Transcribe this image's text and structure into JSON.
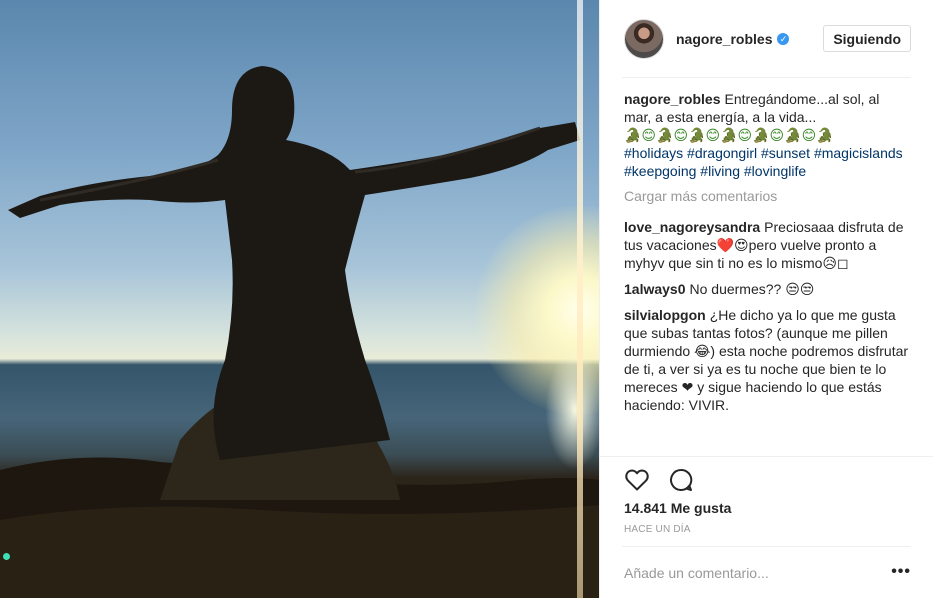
{
  "post": {
    "author": {
      "username": "nagore_robles",
      "verified_icon": "verified-badge-icon",
      "follow_label": "Siguiendo"
    },
    "caption": {
      "username": "nagore_robles",
      "text": "Entregándome...al sol, al mar, a esta energía, a la vida...",
      "emoji_line": "🐊😊🐊😊🐊😊🐊😊🐊😊🐊😊🐊",
      "hashtags": [
        "#holidays",
        "#dragongirl",
        "#sunset",
        "#magicislands",
        "#keepgoing",
        "#living",
        "#lovinglife"
      ]
    },
    "load_more_label": "Cargar más comentarios",
    "comments": [
      {
        "username": "love_nagoreysandra",
        "text": "Preciosaaa disfruta de tus vacaciones❤️😍pero vuelve pronto a myhyv que sin ti no es lo mismo😥◻"
      },
      {
        "username": "1always0",
        "text": "No duermes?? 😒😒"
      },
      {
        "username": "silvialopgon",
        "text": "¿He dicho ya lo que me gusta que subas tantas fotos? (aunque me pillen durmiendo 😂) esta noche podremos disfrutar de ti, a ver si ya es tu noche que bien te lo mereces ❤ y sigue haciendo lo que estás haciendo: VIVIR."
      }
    ],
    "actions": {
      "like_icon": "heart-icon",
      "comment_icon": "comment-bubble-icon"
    },
    "likes_text": "14.841 Me gusta",
    "timestamp": "HACE UN DÍA",
    "add_comment_placeholder": "Añade un comentario...",
    "more_options_label": "•••",
    "colors": {
      "hashtag": "#003569",
      "verified": "#3897f0",
      "muted": "#999999",
      "border": "#efefef"
    }
  }
}
